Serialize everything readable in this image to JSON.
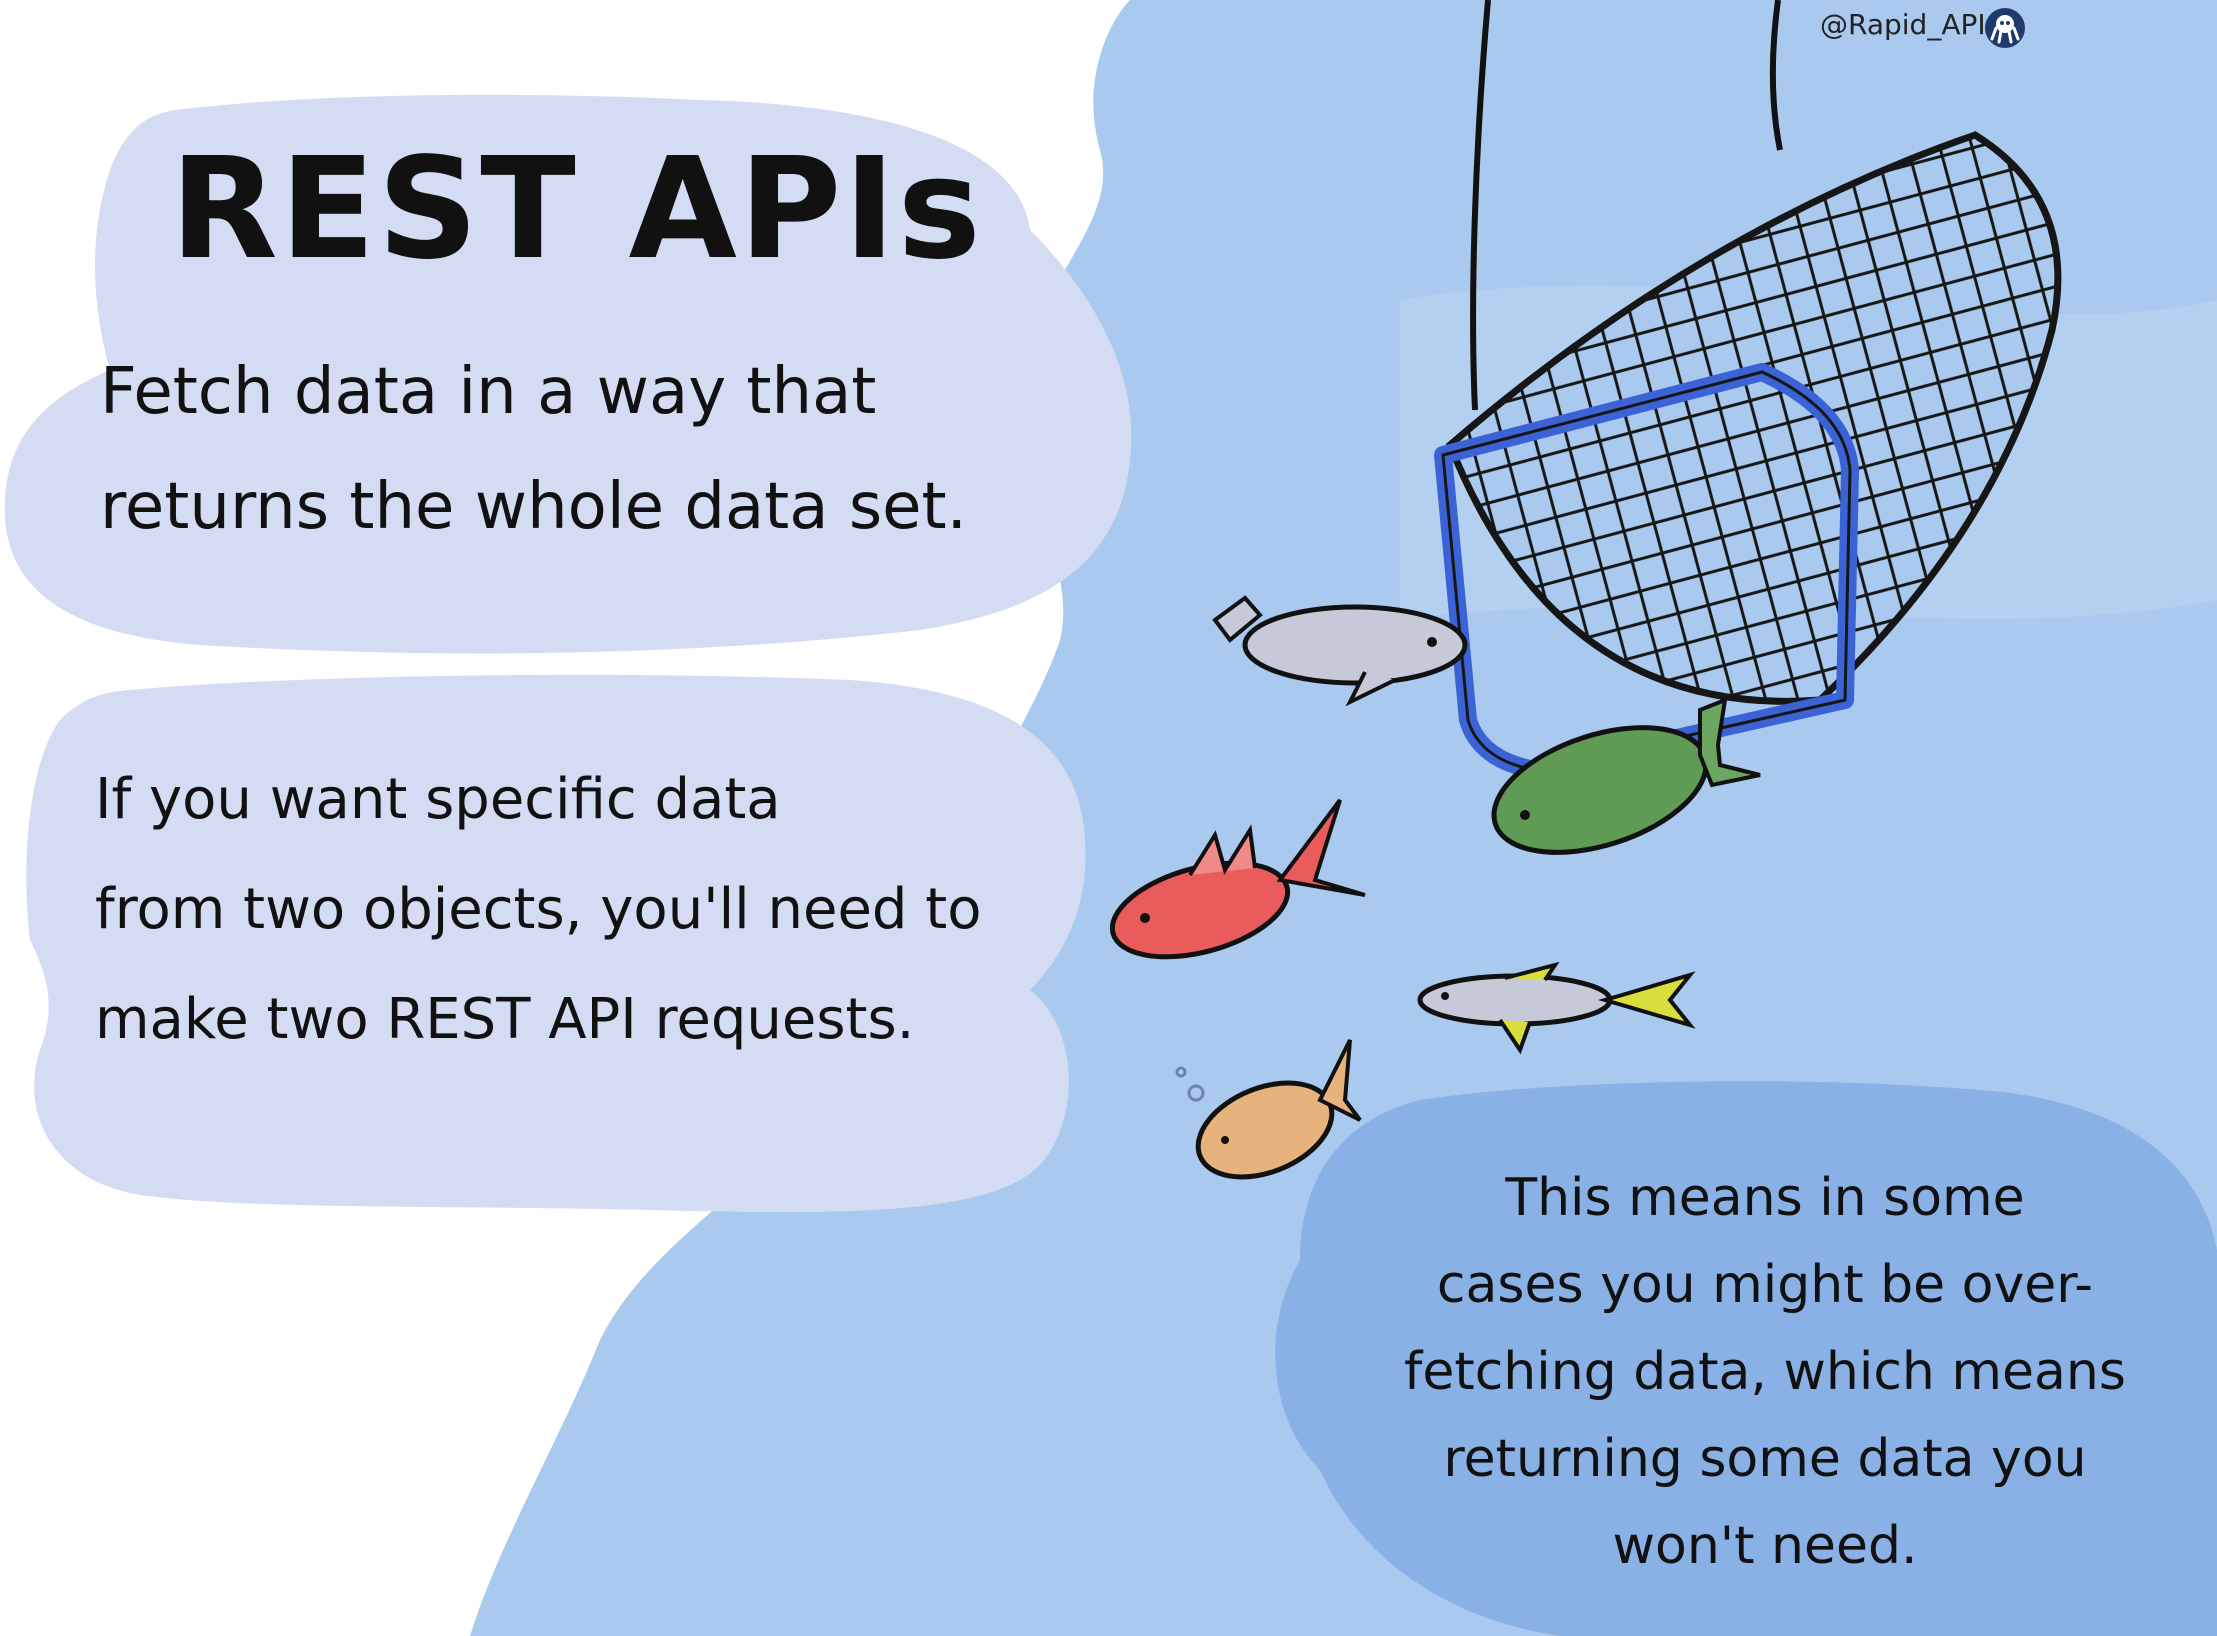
{
  "credit": {
    "handle": "@Rapid_API",
    "logo_icon": "octopus-logo-icon"
  },
  "title": "REST APIs",
  "bubbles": [
    {
      "text": "Fetch data in a way that\nreturns the whole data set."
    },
    {
      "text": "If you want specific data\nfrom two objects, you'll need to\nmake two REST API requests."
    },
    {
      "text": "This means in some\ncases you might be over-\nfetching data, which means\nreturning some data you\nwon't need."
    }
  ],
  "colors": {
    "water": "#a9c9ee",
    "bubble": "#d4dcf3",
    "bubble_blue": "#89b1e6",
    "net_frame": "#3b63d6",
    "net_mesh": "#161616",
    "fish_grey": "#c6c9d8",
    "fish_green": "#5f9b55",
    "fish_red": "#ea5b5b",
    "fish_yellow_tuna": "#d9de3c",
    "fish_orange": "#e7b27c"
  }
}
